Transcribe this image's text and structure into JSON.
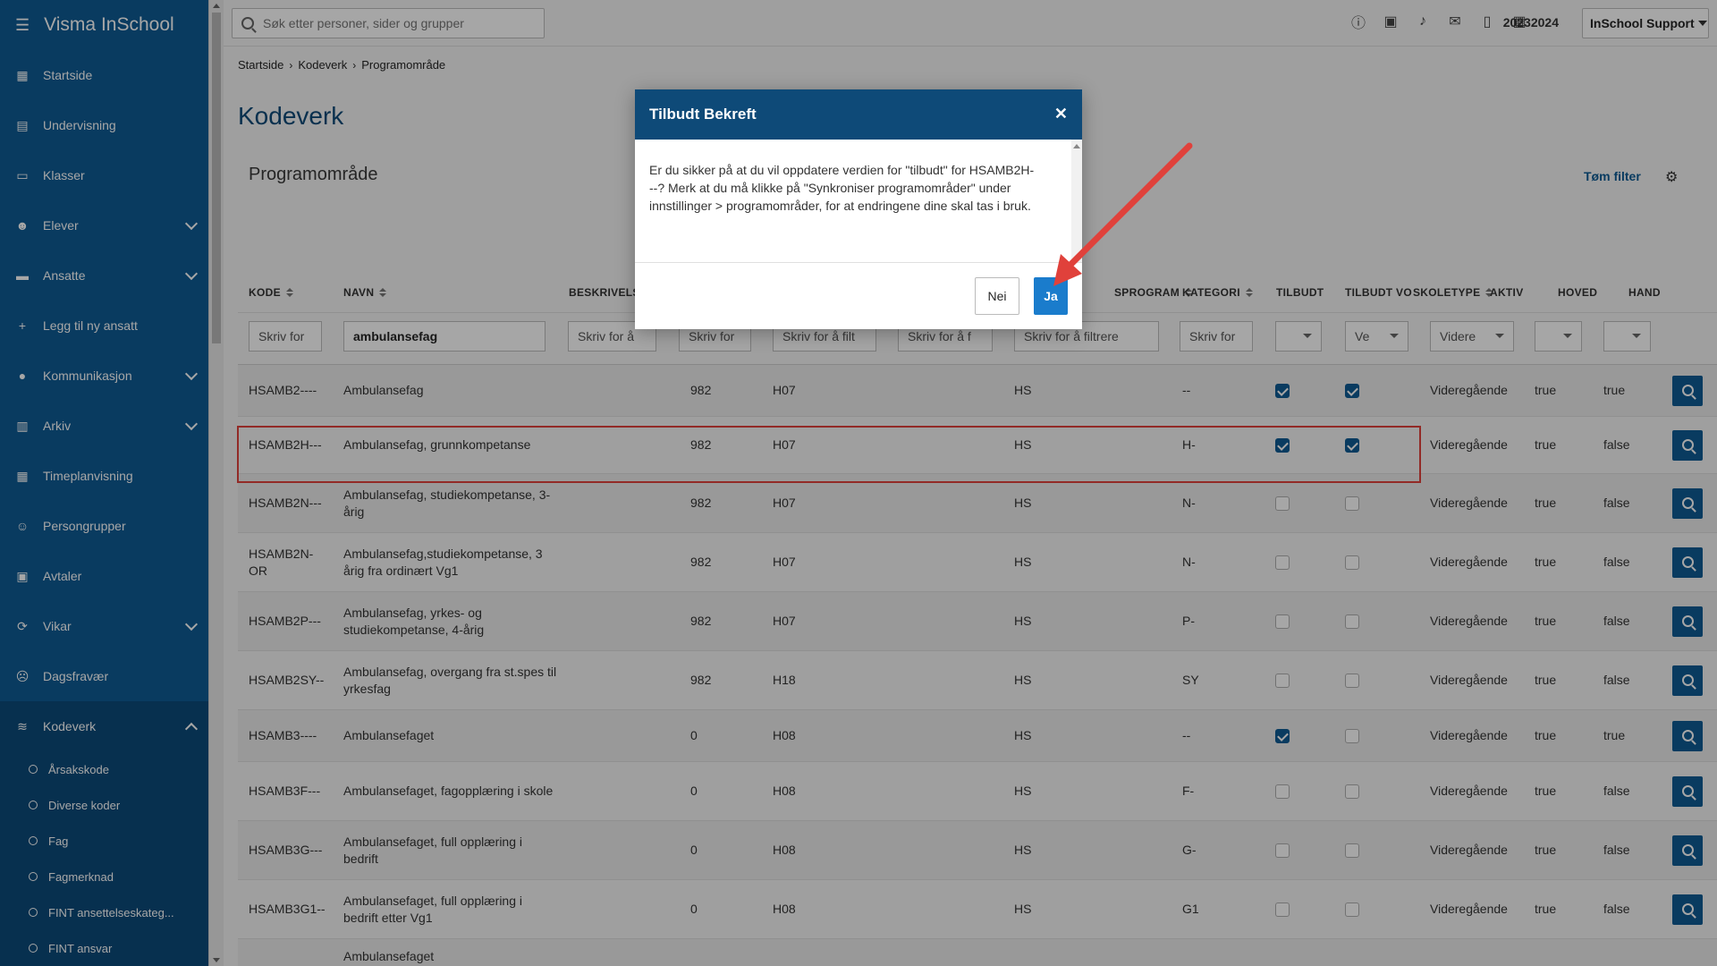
{
  "app": {
    "title": "Visma InSchool"
  },
  "sidebar": {
    "items": [
      {
        "label": "Startside",
        "icon": "grid-icon",
        "expandable": false
      },
      {
        "label": "Undervisning",
        "icon": "book-icon",
        "expandable": false
      },
      {
        "label": "Klasser",
        "icon": "board-icon",
        "expandable": false
      },
      {
        "label": "Elever",
        "icon": "student-icon",
        "expandable": true
      },
      {
        "label": "Ansatte",
        "icon": "briefcase-icon",
        "expandable": true
      },
      {
        "label": "Legg til ny ansatt",
        "icon": "plus-icon",
        "expandable": false
      },
      {
        "label": "Kommunikasjon",
        "icon": "chat-icon",
        "expandable": true
      },
      {
        "label": "Arkiv",
        "icon": "archive-icon",
        "expandable": true
      },
      {
        "label": "Timeplanvisning",
        "icon": "calendar-icon",
        "expandable": false
      },
      {
        "label": "Persongrupper",
        "icon": "people-icon",
        "expandable": false
      },
      {
        "label": "Avtaler",
        "icon": "calendar-check-icon",
        "expandable": false
      },
      {
        "label": "Vikar",
        "icon": "swap-icon",
        "expandable": true
      },
      {
        "label": "Dagsfravær",
        "icon": "user-absent-icon",
        "expandable": false
      },
      {
        "label": "Kodeverk",
        "icon": "database-icon",
        "expandable": true,
        "expanded": true
      }
    ],
    "sub_items": [
      "Årsakskode",
      "Diverse koder",
      "Fag",
      "Fagmerknad",
      "FINT ansettelseskateg...",
      "FINT ansvar"
    ]
  },
  "topbar": {
    "search_placeholder": "Søk etter personer, sider og grupper",
    "date": "20232024",
    "user": "InSchool Support"
  },
  "breadcrumb": [
    "Startside",
    "Kodeverk",
    "Programområde"
  ],
  "page": {
    "title": "Kodeverk",
    "section": "Programområde",
    "clear_filter": "Tøm filter"
  },
  "table": {
    "columns": [
      "KODE",
      "NAVN",
      "BESKRIVELSE",
      "",
      "",
      "",
      "SPROGRAM",
      "KATEGORI",
      "TILBUDT",
      "TILBUDT VO",
      "SKOLETYPE",
      "AKTIV",
      "HOVED",
      "HAND"
    ],
    "filters": {
      "kode": "Skriv for",
      "navn": "ambulansefag",
      "beskrivelse": "Skriv for å",
      "col4": "Skriv for",
      "col5": "Skriv for å filt",
      "col6": "Skriv for å f",
      "sprogram": "Skriv for å filtrere",
      "kategori": "Skriv for",
      "tilbudt_vo": "Ve",
      "skoletype": "Videre"
    },
    "rows": [
      {
        "kode": "HSAMB2----",
        "navn": "Ambulansefag",
        "n": "982",
        "h": "H07",
        "hs": "HS",
        "kat": "--",
        "tilbudt": true,
        "tilbudt_vo": true,
        "skoletype": "Videregående",
        "aktiv": "true",
        "hoved": "true"
      },
      {
        "kode": "HSAMB2H---",
        "navn": "Ambulansefag, grunnkompetanse",
        "n": "982",
        "h": "H07",
        "hs": "HS",
        "kat": "H-",
        "tilbudt": true,
        "tilbudt_vo": true,
        "skoletype": "Videregående",
        "aktiv": "true",
        "hoved": "false"
      },
      {
        "kode": "HSAMB2N---",
        "navn": "Ambulansefag, studiekompetanse, 3-årig",
        "n": "982",
        "h": "H07",
        "hs": "HS",
        "kat": "N-",
        "tilbudt": false,
        "tilbudt_vo": false,
        "skoletype": "Videregående",
        "aktiv": "true",
        "hoved": "false"
      },
      {
        "kode": "HSAMB2N-OR",
        "navn": "Ambulansefag,studiekompetanse, 3 årig fra ordinært Vg1",
        "n": "982",
        "h": "H07",
        "hs": "HS",
        "kat": "N-",
        "tilbudt": false,
        "tilbudt_vo": false,
        "skoletype": "Videregående",
        "aktiv": "true",
        "hoved": "false"
      },
      {
        "kode": "HSAMB2P---",
        "navn": "Ambulansefag, yrkes- og studiekompetanse, 4-årig",
        "n": "982",
        "h": "H07",
        "hs": "HS",
        "kat": "P-",
        "tilbudt": false,
        "tilbudt_vo": false,
        "skoletype": "Videregående",
        "aktiv": "true",
        "hoved": "false"
      },
      {
        "kode": "HSAMB2SY--",
        "navn": "Ambulansefag, overgang fra st.spes til yrkesfag",
        "n": "982",
        "h": "H18",
        "hs": "HS",
        "kat": "SY",
        "tilbudt": false,
        "tilbudt_vo": false,
        "skoletype": "Videregående",
        "aktiv": "true",
        "hoved": "false"
      },
      {
        "kode": "HSAMB3----",
        "navn": "Ambulansefaget",
        "n": "0",
        "h": "H08",
        "hs": "HS",
        "kat": "--",
        "tilbudt": true,
        "tilbudt_vo": false,
        "skoletype": "Videregående",
        "aktiv": "true",
        "hoved": "true"
      },
      {
        "kode": "HSAMB3F---",
        "navn": "Ambulansefaget, fagopplæring i skole",
        "n": "0",
        "h": "H08",
        "hs": "HS",
        "kat": "F-",
        "tilbudt": false,
        "tilbudt_vo": false,
        "skoletype": "Videregående",
        "aktiv": "true",
        "hoved": "false"
      },
      {
        "kode": "HSAMB3G---",
        "navn": "Ambulansefaget, full opplæring i bedrift",
        "n": "0",
        "h": "H08",
        "hs": "HS",
        "kat": "G-",
        "tilbudt": false,
        "tilbudt_vo": false,
        "skoletype": "Videregående",
        "aktiv": "true",
        "hoved": "false"
      },
      {
        "kode": "HSAMB3G1--",
        "navn": "Ambulansefaget, full opplæring i bedrift etter Vg1",
        "n": "0",
        "h": "H08",
        "hs": "HS",
        "kat": "G1",
        "tilbudt": false,
        "tilbudt_vo": false,
        "skoletype": "Videregående",
        "aktiv": "true",
        "hoved": "false"
      },
      {
        "kode": "",
        "navn": "Ambulansefaget",
        "n": "",
        "h": "",
        "hs": "",
        "kat": "",
        "tilbudt": false,
        "tilbudt_vo": false,
        "skoletype": "",
        "aktiv": "",
        "hoved": ""
      }
    ]
  },
  "modal": {
    "title": "Tilbudt Bekreft",
    "body": "Er du sikker på at du vil oppdatere verdien for \"tilbudt\" for HSAMB2H---? Merk at du må klikke på \"Synkroniser programområder\" under innstillinger > programområder, for at endringene dine skal tas i bruk.",
    "no_label": "Nei",
    "yes_label": "Ja"
  },
  "colors": {
    "sidebar": "#0e5b94",
    "accent": "#1a7ccc",
    "modal_header": "#0e4a78",
    "highlight": "#e0413b"
  }
}
